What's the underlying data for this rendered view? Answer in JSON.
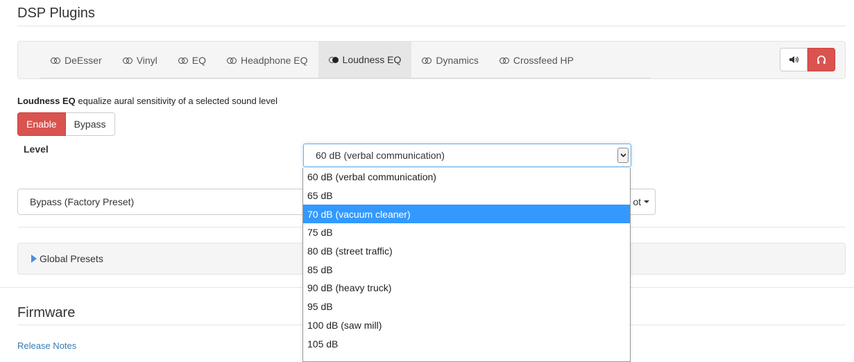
{
  "page": {
    "section_title": "DSP Plugins"
  },
  "tabs": [
    {
      "label": "DeEsser",
      "icon": "toggle-icon",
      "active": false
    },
    {
      "label": "Vinyl",
      "icon": "toggle-icon",
      "active": false
    },
    {
      "label": "EQ",
      "icon": "toggle-icon",
      "active": false
    },
    {
      "label": "Headphone EQ",
      "icon": "toggle-icon",
      "active": false
    },
    {
      "label": "Loudness EQ",
      "icon": "toggle-on-icon",
      "active": true
    },
    {
      "label": "Dynamics",
      "icon": "toggle-icon",
      "active": false
    },
    {
      "label": "Crossfeed HP",
      "icon": "toggle-icon",
      "active": false
    }
  ],
  "output_switch": {
    "speaker_icon": "speaker-icon",
    "headphone_icon": "headphone-icon",
    "active": "headphone"
  },
  "plugin": {
    "name": "Loudness EQ",
    "description": "equalize aural sensitivity of a selected sound level",
    "enable_label": "Enable",
    "bypass_label": "Bypass",
    "level_label": "Level",
    "level_value": "60 dB (verbal communication)"
  },
  "level_options": [
    "60 dB (verbal communication)",
    "65 dB",
    "70 dB (vacuum cleaner)",
    "75 dB",
    "80 dB (street traffic)",
    "85 dB",
    "90 dB (heavy truck)",
    "95 dB",
    "100 dB (saw mill)",
    "105 dB"
  ],
  "highlighted_option": "70 dB (vacuum cleaner)",
  "presets": {
    "current": "Bypass (Factory Preset)",
    "button_label": "ot"
  },
  "global_presets": {
    "label": "Global Presets"
  },
  "firmware": {
    "title": "Firmware",
    "release_notes": "Release Notes"
  },
  "colors": {
    "accent_red": "#d9534f",
    "highlight_blue": "#3399ff",
    "link_blue": "#337ab7"
  }
}
